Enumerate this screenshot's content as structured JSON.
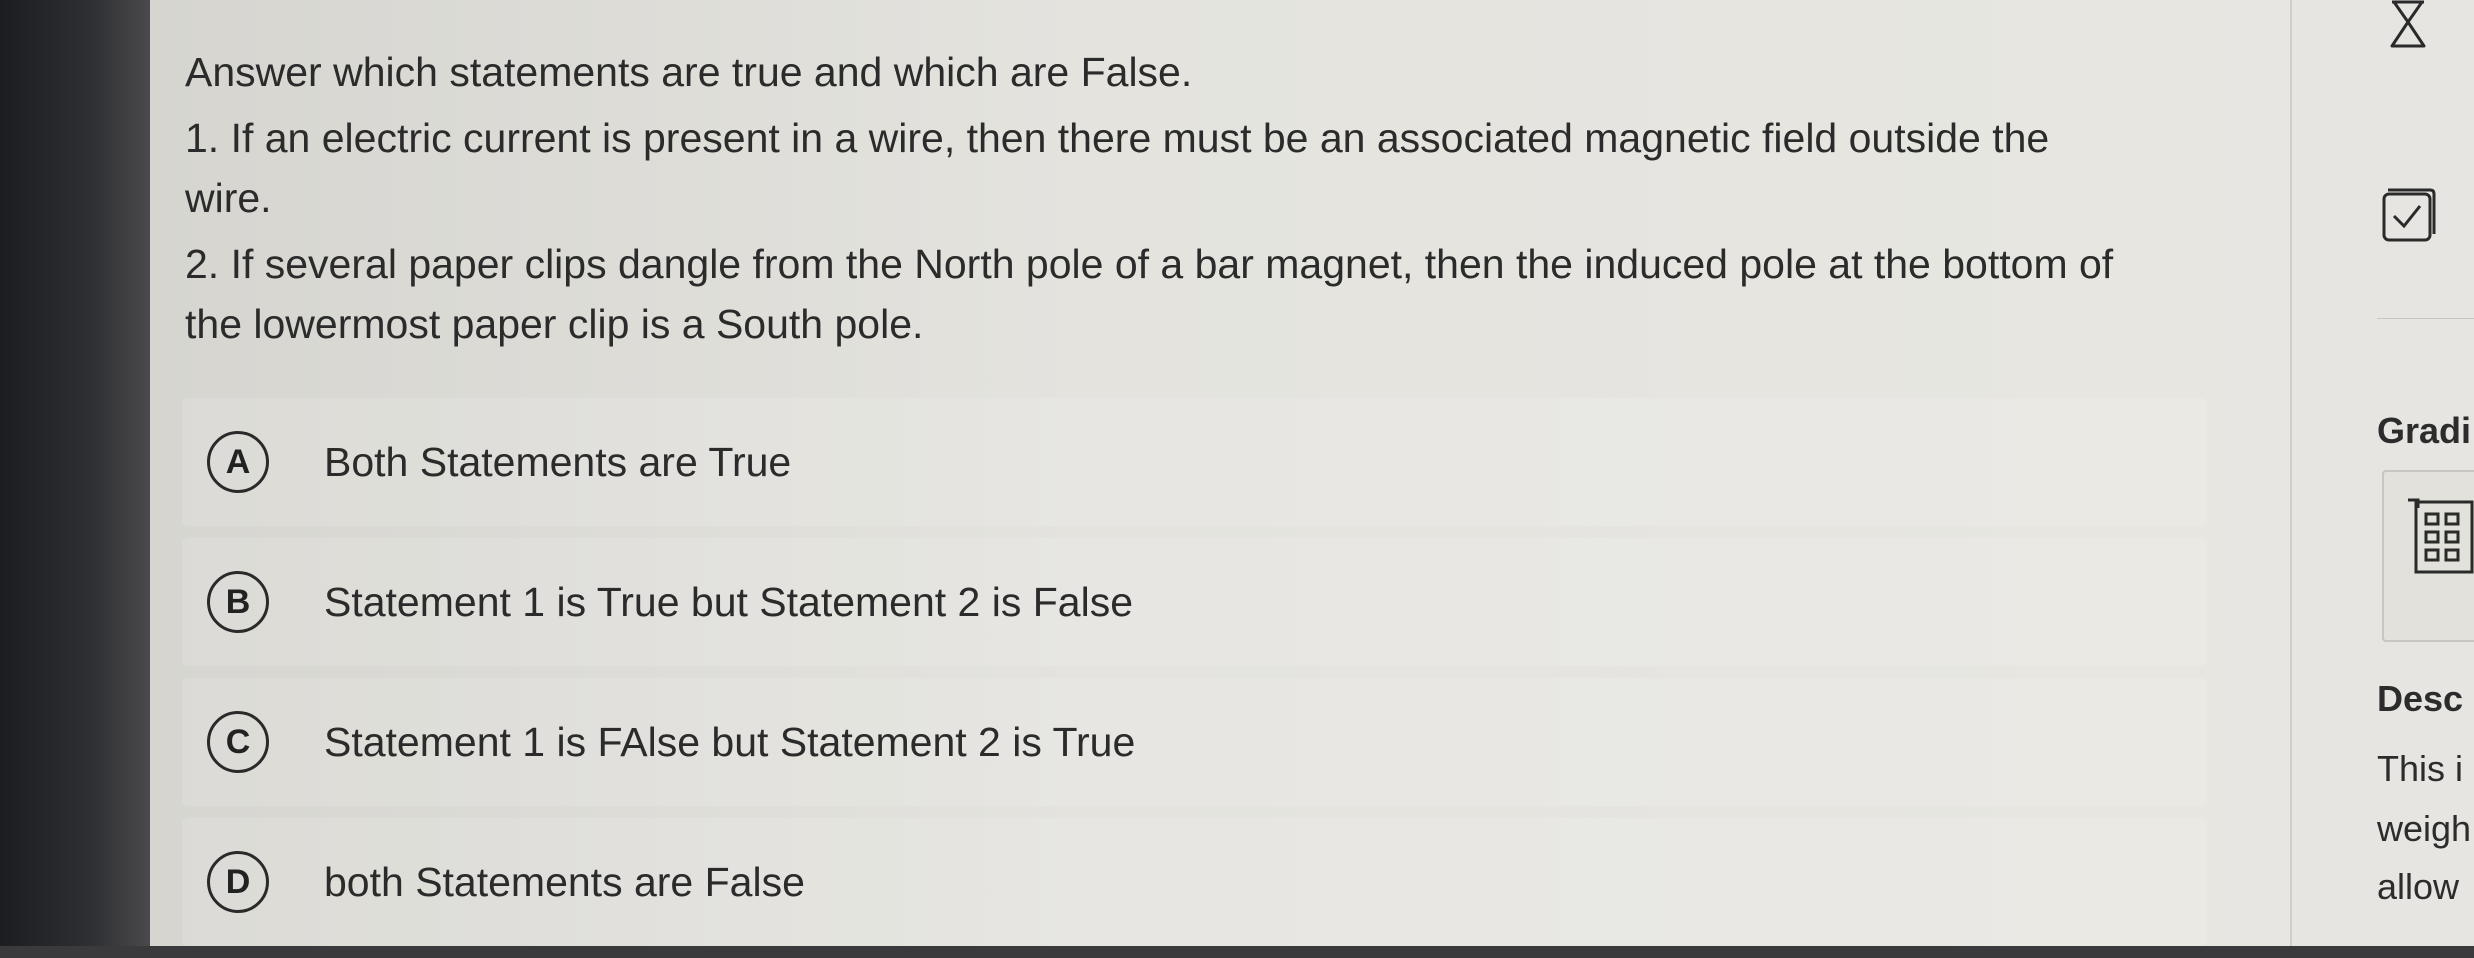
{
  "question": {
    "intro": "Answer which statements are true and which are False.",
    "statement1": "1. If an electric current is present in a wire, then there must be an associated magnetic field outside the",
    "statement1_cont": "wire.",
    "statement2": "2. If several paper clips dangle from the North pole of a bar magnet, then the induced pole at the bottom of",
    "statement2_cont": "the lowermost paper clip is a South pole."
  },
  "options": [
    {
      "letter": "A",
      "text": "Both Statements are True"
    },
    {
      "letter": "B",
      "text": "Statement 1 is True but Statement 2 is False"
    },
    {
      "letter": "C",
      "text": "Statement 1 is FAlse but Statement 2 is True"
    },
    {
      "letter": "D",
      "text": "both Statements are False"
    }
  ],
  "sidebar": {
    "grading_heading": "Gradi",
    "description_heading": "Desc",
    "description_lines": [
      "This i",
      "weigh",
      "allow"
    ],
    "icons": [
      "flag-icon",
      "checklist-icon",
      "calculator-icon"
    ]
  }
}
